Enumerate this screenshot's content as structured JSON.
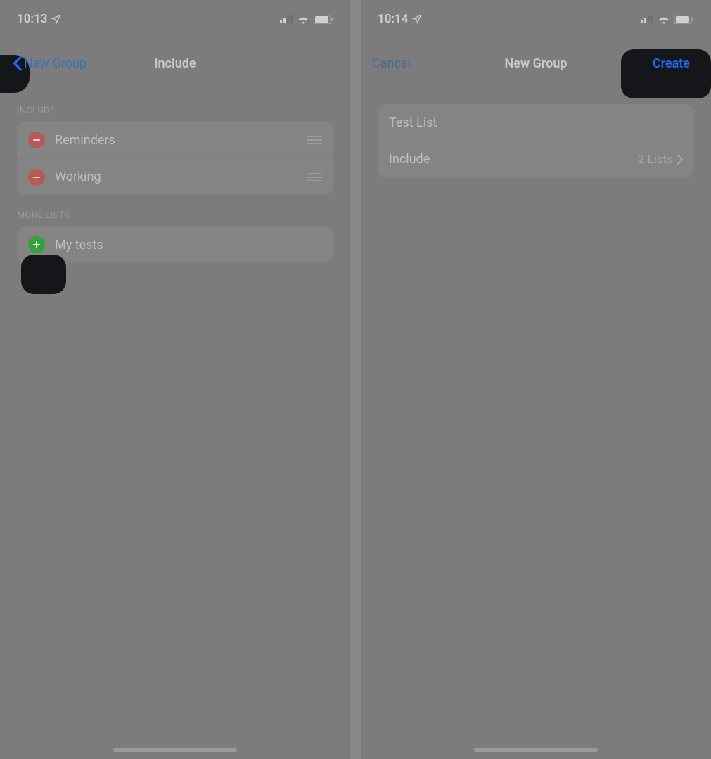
{
  "left": {
    "status": {
      "time": "10:13"
    },
    "nav": {
      "back_label": "New Group",
      "title": "Include"
    },
    "sections": {
      "include": {
        "header": "INCLUDE",
        "items": [
          {
            "label": "Reminders"
          },
          {
            "label": "Working"
          }
        ]
      },
      "more": {
        "header": "MORE LISTS",
        "items": [
          {
            "label": "My tests"
          }
        ]
      }
    }
  },
  "right": {
    "status": {
      "time": "10:14"
    },
    "nav": {
      "cancel_label": "Cancel",
      "title": "New Group",
      "create_label": "Create"
    },
    "form": {
      "name_value": "Test List",
      "include_label": "Include",
      "include_value": "2 Lists"
    }
  }
}
